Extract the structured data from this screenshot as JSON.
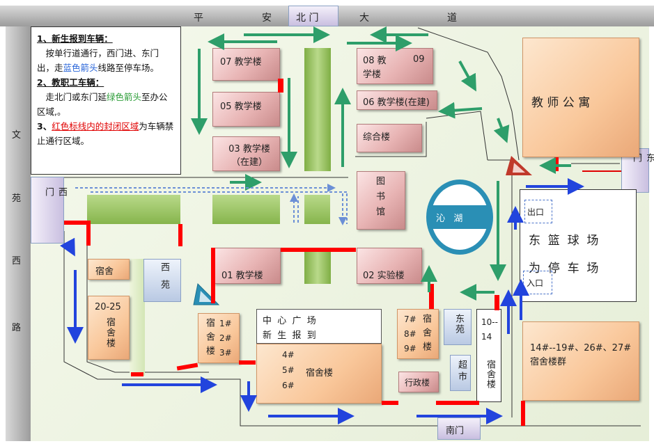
{
  "roads": {
    "north_road": "平 安 北 门 大 道",
    "north_road_chars": [
      "平",
      "安",
      "北",
      "门",
      "大",
      "道"
    ],
    "west_road_chars": [
      "文",
      "苑",
      "西",
      "路"
    ]
  },
  "legend": {
    "item1_title": "1、新生报到车辆：",
    "item1_text_a": "按单行道通行，西门进、东门出，走",
    "item1_highlight": "蓝色箭头",
    "item1_text_b": "线路至停车场。",
    "item2_title": "2、教职工车辆：",
    "item2_text_a": "走北门或东门延",
    "item2_highlight": "绿色箭头",
    "item2_text_b": "至办公区域,。",
    "item3_prefix": "3、",
    "item3_highlight": "红色标线内的封闭区域",
    "item3_text": "为车辆禁止通行区域。"
  },
  "gates": {
    "north": "北 门",
    "west": "西门",
    "east": "东门",
    "south": "南门"
  },
  "buildings": {
    "b07": "07 教学楼",
    "b08": "08 教学楼",
    "b09": "09",
    "b06": "06 教学楼(在建)",
    "b05": "05 教学楼",
    "b03": "03 教学楼（在建）",
    "complex": "综合楼",
    "library": "图书馆",
    "lake": "沁   湖",
    "teacher_apt": "教  师  公  寓",
    "b01": "01 教学楼",
    "b02": "02 实验楼",
    "dorm_small": "宿舍",
    "dorm_20_25_num": "20-25",
    "dorm_20_25_name": "宿舍楼",
    "xiyuan": "西苑",
    "dorm_123_name": "宿舍楼",
    "dorm_123_nums": [
      "1#",
      "2#",
      "3#"
    ],
    "plaza_line1": "中  心  广  场",
    "plaza_line2": "新  生  报  到",
    "dorm_456_nums": [
      "4#",
      "5#",
      "6#"
    ],
    "dorm_456_name": "宿舍楼",
    "dorm_789_nums": [
      "7#",
      "8#",
      "9#"
    ],
    "dorm_789_name": "宿舍楼",
    "dongyuan": "东苑",
    "supermarket": "超市",
    "admin": "行政楼",
    "dorm_10_14_num": "10--14",
    "dorm_10_14_name": "宿舍楼",
    "dorm_group": "14#--19#、26#、27#宿舍楼群",
    "exit": "出口",
    "entrance": "入口",
    "court_line1": "东  篮  球  场",
    "court_line2": "为  停  车  场"
  },
  "colors": {
    "green_arrow": "#2e9e6a",
    "blue_arrow": "#2244dd",
    "red_line": "#ff0000"
  }
}
